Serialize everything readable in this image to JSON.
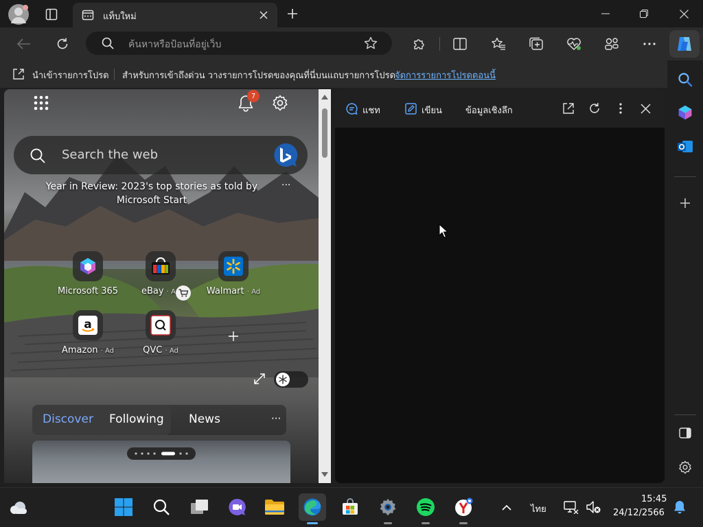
{
  "tab": {
    "title": "แท็บใหม่"
  },
  "address": {
    "placeholder": "ค้นหาหรือป้อนที่อยู่เว็บ"
  },
  "favorites_bar": {
    "import_label": "นำเข้ารายการโปรด",
    "message": "สำหรับการเข้าถึงด่วน วางรายการโปรดของคุณที่นี่บนแถบรายการโปรด",
    "manage_link": "จัดการรายการโปรดตอนนี้"
  },
  "newtab": {
    "notification_count": "7",
    "search_placeholder": "Search the web",
    "headline": "Year in Review: 2023's top stories as told by Microsoft Start",
    "more": "···",
    "tiles": [
      {
        "label": "Microsoft 365",
        "ad": ""
      },
      {
        "label": "eBay",
        "ad": "· Ad"
      },
      {
        "label": "Walmart",
        "ad": "· Ad"
      },
      {
        "label": "Amazon",
        "ad": "· Ad"
      },
      {
        "label": "QVC",
        "ad": "· Ad"
      }
    ],
    "feed_tabs": {
      "discover": "Discover",
      "following": "Following",
      "news": "News",
      "more": "···"
    }
  },
  "copilot": {
    "tabs": {
      "chat": "แชท",
      "compose": "เขียน",
      "insights": "ข้อมูลเชิงลึก"
    }
  },
  "taskbar": {
    "language": "ไทย",
    "time": "15:45",
    "date": "24/12/2566"
  },
  "colors": {
    "accent": "#5fb2ff",
    "link": "#6cb3ff",
    "badge": "#d9472b"
  }
}
